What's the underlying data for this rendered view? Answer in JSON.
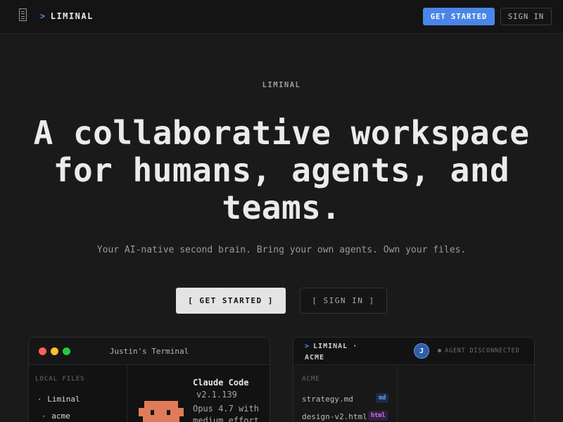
{
  "nav": {
    "logo_icon": "document-icon",
    "brand_prompt": ">",
    "brand": "LIMINAL",
    "get_started": "GET STARTED",
    "sign_in": "SIGN IN"
  },
  "hero": {
    "eyebrow": "LIMINAL",
    "headline": "A collaborative workspace for humans, agents, and teams.",
    "subhead": "Your AI-native second brain. Bring your own agents. Own your files.",
    "cta_primary": "[ GET STARTED ]",
    "cta_secondary": "[ SIGN IN ]"
  },
  "terminal": {
    "title": "Justin's Terminal",
    "sidebar_label": "LOCAL FILES",
    "tree": [
      {
        "label": "Liminal",
        "icon": "chevron-down-icon"
      },
      {
        "label": "acme",
        "icon": "chevron-down-icon"
      }
    ],
    "agent_name": "Claude Code",
    "agent_version": "v2.1.139",
    "agent_model": "Opus 4.7 with medium effort"
  },
  "workspace": {
    "title_prompt": ">",
    "title": "LIMINAL · ACME",
    "avatar_initial": "J",
    "status": "AGENT DISCONNECTED",
    "sidebar_label": "ACME",
    "files": [
      {
        "name": "strategy.md",
        "badge": "md"
      },
      {
        "name": "design-v2.html",
        "badge": "html"
      }
    ]
  },
  "colors": {
    "background": "#1a1a1a",
    "accent": "#4a86e8",
    "pixel_avatar": "#e07b5a"
  }
}
